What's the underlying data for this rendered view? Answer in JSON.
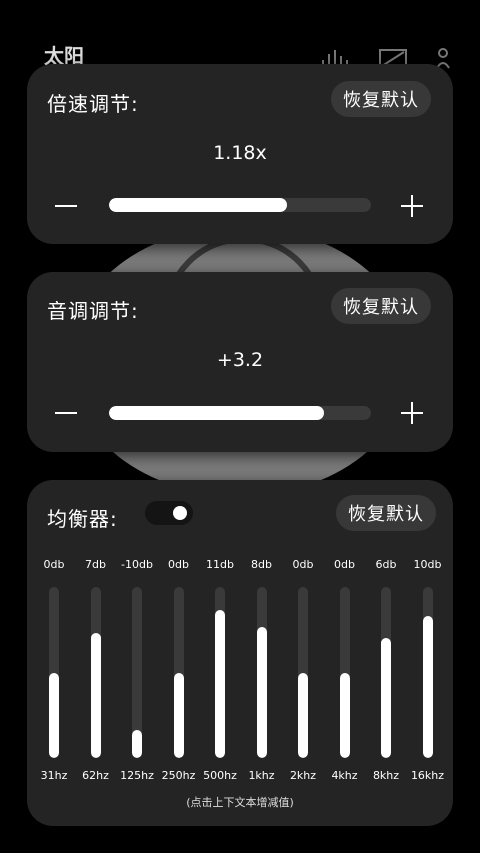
{
  "background": {
    "title": "太阳",
    "icons": [
      "equalizer-icon",
      "expand-icon",
      "user-icon"
    ]
  },
  "speed_card": {
    "title": "倍速调节:",
    "reset_label": "恢复默认",
    "value": "1.18x",
    "slider_fraction": 0.68
  },
  "pitch_card": {
    "title": "音调调节:",
    "reset_label": "恢复默认",
    "value": "+3.2",
    "slider_fraction": 0.82
  },
  "equalizer": {
    "title": "均衡器:",
    "toggle_on": true,
    "reset_label": "恢复默认",
    "hint": "(点击上下文本增减值)",
    "bands": [
      {
        "hz": "31hz",
        "db_label": "0db",
        "db": 0
      },
      {
        "hz": "62hz",
        "db_label": "7db",
        "db": 7
      },
      {
        "hz": "125hz",
        "db_label": "-10db",
        "db": -10
      },
      {
        "hz": "250hz",
        "db_label": "0db",
        "db": 0
      },
      {
        "hz": "500hz",
        "db_label": "11db",
        "db": 11
      },
      {
        "hz": "1khz",
        "db_label": "8db",
        "db": 8
      },
      {
        "hz": "2khz",
        "db_label": "0db",
        "db": 0
      },
      {
        "hz": "4khz",
        "db_label": "0db",
        "db": 0
      },
      {
        "hz": "8khz",
        "db_label": "6db",
        "db": 6
      },
      {
        "hz": "16khz",
        "db_label": "10db",
        "db": 10
      }
    ]
  },
  "colors": {
    "page_bg": "#000000",
    "card_bg": "#242424",
    "button_bg": "#383838",
    "track": "#3a3a3a",
    "fill": "#ffffff"
  }
}
